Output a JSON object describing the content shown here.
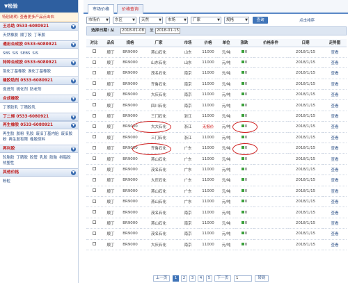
{
  "sidebar": {
    "title": "▼检验",
    "notice": "特别说明: 查看更多产品点击右",
    "sections": [
      {
        "title": "王总助 0533-6080921",
        "links": [
          "天然橡胶",
          "顺丁胶",
          "丁苯胶"
        ]
      },
      {
        "title": "通用合成胶 0533-6080921",
        "links": [
          "SBS",
          "SIS",
          "SEBS",
          "SIS"
        ]
      },
      {
        "title": "特种合成胶 0533-6080921",
        "links": [
          "氯化丁基橡胶",
          "溴化丁基橡胶"
        ]
      },
      {
        "title": "橡胶助剂 0533-6080921",
        "links": [
          "促进剂",
          "硫化剂",
          "防老剂"
        ]
      },
      {
        "title": "合成橡胶",
        "links": [
          "丁苯胶乳",
          "丁腈胶乳"
        ]
      },
      {
        "title": "丁二烯 0533-6080921",
        "links": []
      },
      {
        "title": "再生橡胶 0533-6080921",
        "links": [
          "再生胶",
          "胶粉",
          "乳胶",
          "废旧丁基内胎",
          "废旧胶粉",
          "再生胶有限",
          "橡胶原料"
        ]
      },
      {
        "title": "再利胶",
        "links": [
          "轮胎胶",
          "丁腈胶",
          "胶管",
          "乳胶",
          "胶胎",
          "树脂胶",
          "热塑性"
        ]
      },
      {
        "title": "其他价格",
        "links": [
          "粉粒"
        ]
      }
    ]
  },
  "tabs": [
    "市场价格",
    "价格查询"
  ],
  "filters": {
    "selects": [
      "市场价",
      "东区",
      "天然",
      "市场",
      "厂家",
      "规格"
    ],
    "go_label": "查询",
    "sort_label": "点击排序"
  },
  "datebar": {
    "label": "选择日期: 从",
    "from": "2018-01-08",
    "to_label": "至",
    "to": "2018-01-15"
  },
  "table": {
    "headers": [
      "对比",
      "品名",
      "规格",
      "厂家",
      "市场",
      "价格",
      "单位",
      "涨跌",
      "价格条件",
      "日期",
      "走势图"
    ],
    "rows": [
      [
        "顺丁",
        "BR9000",
        "燕山石化",
        "山东",
        "11000",
        "元/吨",
        "0",
        "",
        "2018/1/15",
        "查看"
      ],
      [
        "顺丁",
        "BR9000",
        "山东石化",
        "山东",
        "11000",
        "元/吨",
        "0",
        "",
        "2018/1/15",
        "查看"
      ],
      [
        "顺丁",
        "BR9000",
        "茂名石化",
        "南京",
        "11000",
        "元/吨",
        "0",
        "",
        "2018/1/15",
        "查看"
      ],
      [
        "顺丁",
        "BR9000",
        "齐鲁石化",
        "南京",
        "11000",
        "元/吨",
        "0",
        "",
        "2018/1/15",
        "查看"
      ],
      [
        "顺丁",
        "BR9000",
        "大庆石化",
        "南京",
        "11000",
        "元/吨",
        "0",
        "",
        "2018/1/15",
        "查看"
      ],
      [
        "顺丁",
        "BR9000",
        "四川石化",
        "南京",
        "11000",
        "元/吨",
        "0",
        "",
        "2018/1/15",
        "查看"
      ],
      [
        "顺丁",
        "BR9000",
        "三门石化",
        "浙江",
        "11000",
        "元/吨",
        "0",
        "",
        "2018/1/15",
        "查看"
      ],
      [
        "顺丁",
        "BR9000",
        "大大石化",
        "浙江",
        "无报价",
        "元/吨",
        "0",
        "",
        "2018/1/15",
        "查看"
      ],
      [
        "顺丁",
        "BR9000",
        "三门石化",
        "浙江",
        "11000",
        "元/吨",
        "0",
        "",
        "2018/1/15",
        "查看"
      ],
      [
        "顺丁",
        "BR9000",
        "齐鲁石化",
        "广东",
        "11000",
        "元/吨",
        "0",
        "",
        "2018/1/15",
        "查看"
      ],
      [
        "顺丁",
        "BR9000",
        "燕山石化",
        "广东",
        "11000",
        "元/吨",
        "0",
        "",
        "2018/1/15",
        "查看"
      ],
      [
        "顺丁",
        "BR9000",
        "茂名石化",
        "广东",
        "11000",
        "元/吨",
        "0",
        "",
        "2018/1/15",
        "查看"
      ],
      [
        "顺丁",
        "BR9000",
        "大庆石化",
        "广东",
        "11000",
        "元/吨",
        "0",
        "",
        "2018/1/15",
        "查看"
      ],
      [
        "顺丁",
        "BR9000",
        "燕山石化",
        "广东",
        "11000",
        "元/吨",
        "0",
        "",
        "2018/1/15",
        "查看"
      ],
      [
        "顺丁",
        "BR9000",
        "燕山石化",
        "广东",
        "11000",
        "元/吨",
        "0",
        "",
        "2018/1/15",
        "查看"
      ],
      [
        "顺丁",
        "BR9000",
        "茂名石化",
        "南京",
        "11000",
        "元/吨",
        "0",
        "",
        "2018/1/15",
        "查看"
      ],
      [
        "顺丁",
        "BR9000",
        "燕山石化",
        "南京",
        "11000",
        "元/吨",
        "0",
        "",
        "2018/1/15",
        "查看"
      ],
      [
        "顺丁",
        "BR9000",
        "茂名石化",
        "南京",
        "11000",
        "元/吨",
        "0",
        "",
        "2018/1/15",
        "查看"
      ],
      [
        "顺丁",
        "BR9000",
        "大庆石化",
        "南京",
        "11000",
        "元/吨",
        "0",
        "",
        "2018/1/15",
        "查看"
      ]
    ]
  },
  "pager": {
    "prev": "上一页",
    "pages": [
      "1",
      "2",
      "3",
      "4",
      "5"
    ],
    "next": "下一页",
    "input": "1",
    "go": "转到"
  },
  "colors": {
    "accent": "#2e5fa0",
    "highlight": "#d02020"
  }
}
